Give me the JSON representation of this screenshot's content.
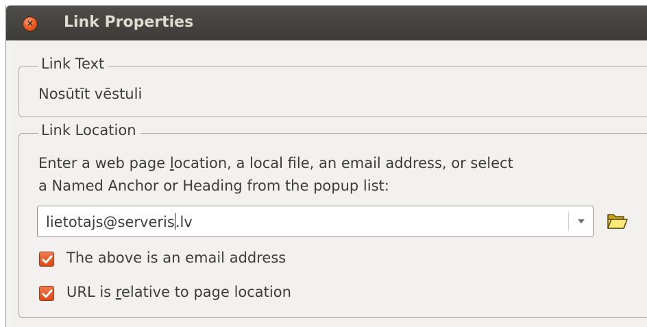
{
  "window": {
    "title": "Link Properties",
    "close_glyph": "×"
  },
  "link_text": {
    "legend": "Link Text",
    "value": "Nosūtīt vēstuli"
  },
  "link_location": {
    "legend": "Link Location",
    "description_line1_before": "Enter a web page ",
    "description_line1_mnemonic": "l",
    "description_line1_after": "ocation, a local file, an email address, or select",
    "description_line2": "a Named Anchor or Heading from the popup list:",
    "input_value_before_caret": "lietotajs@serveris",
    "input_value_after_caret": ".lv",
    "checkbox_email": {
      "label": "The above is an email address",
      "checked": true
    },
    "checkbox_relative": {
      "label_before": "URL is ",
      "label_mnemonic": "r",
      "label_after": "elative to page location",
      "checked": true
    }
  },
  "icons": {
    "close": "close-icon",
    "dropdown": "chevron-down-icon",
    "browse": "folder-open-icon",
    "checkmark": "checkmark-icon"
  },
  "colors": {
    "titlebar": "#3c3b37",
    "accent_orange": "#dd4814",
    "dialog_bg": "#f2f1f0"
  }
}
